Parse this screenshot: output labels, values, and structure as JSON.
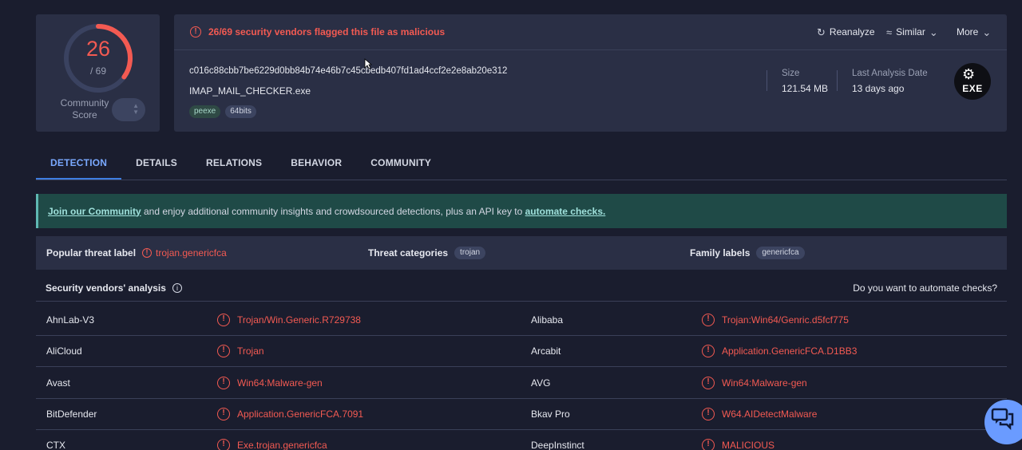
{
  "score": {
    "detected": "26",
    "total": "/ 69",
    "community_label": "Community Score",
    "community_toggle_icon": "chevron-updown-icon"
  },
  "colors": {
    "malicious": "#f35a52",
    "accent": "#3e7de0",
    "panel": "#2a2f45",
    "background": "#1a1d2e"
  },
  "alert": {
    "icon": "alert-circle-icon",
    "text": "26/69 security vendors flagged this file as malicious"
  },
  "actions": {
    "reanalyze": "Reanalyze",
    "similar": "Similar",
    "more": "More"
  },
  "file": {
    "hash": "c016c88cbb7be6229d0bb84b74e46b7c45cbedb407fd1ad4ccf2e2e8ab20e312",
    "name": "IMAP_MAIL_CHECKER.exe",
    "tags": [
      "peexe",
      "64bits"
    ],
    "size_label": "Size",
    "size_value": "121.54 MB",
    "last_analysis_label": "Last Analysis Date",
    "last_analysis_value": "13 days ago",
    "type_badge": "EXE"
  },
  "tabs": [
    {
      "label": "DETECTION",
      "active": true
    },
    {
      "label": "DETAILS",
      "active": false
    },
    {
      "label": "RELATIONS",
      "active": false
    },
    {
      "label": "BEHAVIOR",
      "active": false
    },
    {
      "label": "COMMUNITY",
      "active": false
    }
  ],
  "banner": {
    "link1": "Join our Community",
    "middle": " and enjoy additional community insights and crowdsourced detections, plus an API key to ",
    "link2": "automate checks."
  },
  "threat": {
    "popular_label": "Popular threat label",
    "popular_value": "trojan.genericfca",
    "categories_label": "Threat categories",
    "categories_value": "trojan",
    "family_label": "Family labels",
    "family_value": "genericfca"
  },
  "vendors": {
    "title": "Security vendors' analysis",
    "automate_prompt": "Do you want to automate checks?",
    "rows": [
      {
        "left_vendor": "AhnLab-V3",
        "left_result": "Trojan/Win.Generic.R729738",
        "right_vendor": "Alibaba",
        "right_result": "Trojan:Win64/Genric.d5fcf775"
      },
      {
        "left_vendor": "AliCloud",
        "left_result": "Trojan",
        "right_vendor": "Arcabit",
        "right_result": "Application.GenericFCA.D1BB3"
      },
      {
        "left_vendor": "Avast",
        "left_result": "Win64:Malware-gen",
        "right_vendor": "AVG",
        "right_result": "Win64:Malware-gen"
      },
      {
        "left_vendor": "BitDefender",
        "left_result": "Application.GenericFCA.7091",
        "right_vendor": "Bkav Pro",
        "right_result": "W64.AIDetectMalware"
      },
      {
        "left_vendor": "CTX",
        "left_result": "Exe.trojan.genericfca",
        "right_vendor": "DeepInstinct",
        "right_result": "MALICIOUS"
      }
    ]
  }
}
